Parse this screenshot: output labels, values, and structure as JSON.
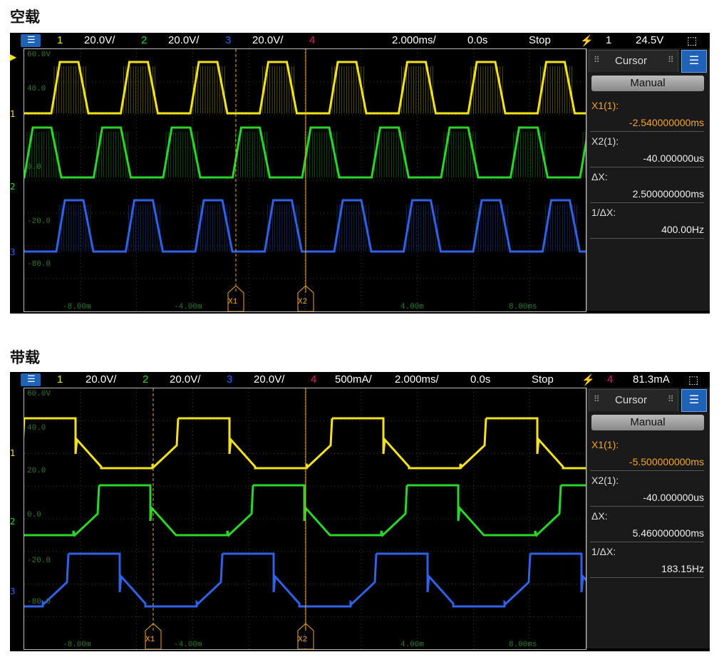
{
  "panels": [
    {
      "heading": "空载",
      "toolbar": {
        "menu_icon": "menu-icon",
        "ch1_num": "1",
        "ch1_scale": "20.0V/",
        "ch2_num": "2",
        "ch2_scale": "20.0V/",
        "ch3_num": "3",
        "ch3_scale": "20.0V/",
        "ch4_num": "4",
        "ch4_scale": "",
        "timebase": "2.000ms/",
        "delay": "0.0s",
        "run_state": "Stop",
        "trigger_icon": "trigger-edge-icon",
        "trigger_channel": "1",
        "trigger_level": "24.5V",
        "zoom_icon": "zoom-box-icon"
      },
      "grid_labels": {
        "y1": "60.0V",
        "y2": "40.0",
        "y3": "0.0",
        "y4": "-20.0",
        "y5": "-80.0",
        "x1": "-8.00m",
        "x2": "-4.00m",
        "x3": "4.00m",
        "x4": "8.00ms"
      },
      "markers": {
        "x1": "X1",
        "x2": "X2"
      },
      "cursor_panel": {
        "tab": "Cursor",
        "mode": "Manual",
        "x1_label": "X1(1):",
        "x1_value": "-2.540000000ms",
        "x2_label": "X2(1):",
        "x2_value": "-40.000000us",
        "dx_label": "ΔX:",
        "dx_value": "2.500000000ms",
        "inv_label": "1/ΔX:",
        "inv_value": "400.00Hz"
      },
      "ch_markers": {
        "c1": "1",
        "c2": "2",
        "c3": "3"
      }
    },
    {
      "heading": "带载",
      "toolbar": {
        "menu_icon": "menu-icon",
        "ch1_num": "1",
        "ch1_scale": "20.0V/",
        "ch2_num": "2",
        "ch2_scale": "20.0V/",
        "ch3_num": "3",
        "ch3_scale": "20.0V/",
        "ch4_num": "4",
        "ch4_scale": "500mA/",
        "timebase": "2.000ms/",
        "delay": "0.0s",
        "run_state": "Stop",
        "trigger_icon": "trigger-edge-icon",
        "trigger_channel": "4",
        "trigger_level": "81.3mA",
        "zoom_icon": "zoom-box-icon"
      },
      "grid_labels": {
        "y1": "60.0V",
        "y2": "40.0",
        "y3": "20.0",
        "y4": "0.0",
        "y5": "-20.0",
        "y6": "-80.0",
        "x1": "-8.00m",
        "x2": "-4.00m",
        "x3": "4.00m",
        "x4": "8.00ms"
      },
      "markers": {
        "x1": "X1",
        "x2": "X2"
      },
      "cursor_panel": {
        "tab": "Cursor",
        "mode": "Manual",
        "x1_label": "X1(1):",
        "x1_value": "-5.500000000ms",
        "x2_label": "X2(1):",
        "x2_value": "-40.000000us",
        "dx_label": "ΔX:",
        "dx_value": "5.460000000ms",
        "inv_label": "1/ΔX:",
        "inv_value": "183.15Hz"
      },
      "ch_markers": {
        "c1": "1",
        "c2": "2",
        "c3": "3"
      }
    }
  ],
  "colors": {
    "ch1": "#f2e21a",
    "ch2": "#29d629",
    "ch3": "#2f62e8",
    "ch4": "#e8196e",
    "cursor": "#f5a623",
    "accent": "#1e63b8"
  }
}
